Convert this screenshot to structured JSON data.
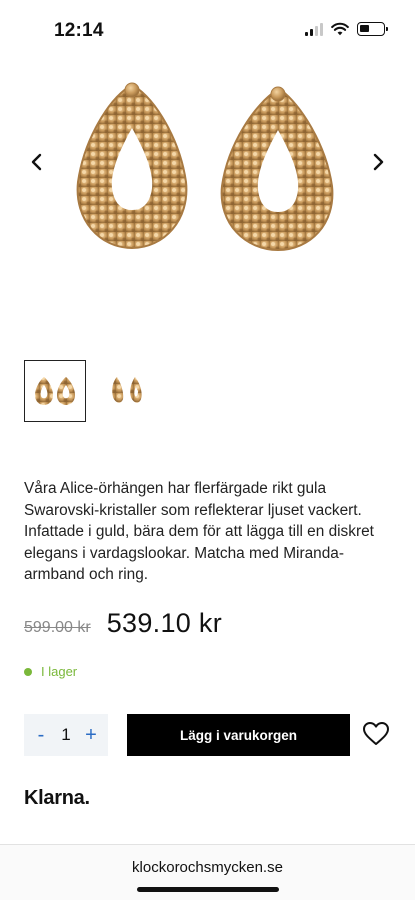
{
  "status_bar": {
    "time": "12:14"
  },
  "gallery": {
    "prev_icon": "chevron-left-icon",
    "next_icon": "chevron-right-icon",
    "thumbnails": [
      "earrings-front",
      "earrings-side"
    ],
    "active_thumbnail": 0,
    "gem_color": "#c99a5c"
  },
  "product": {
    "description": "Våra Alice-örhängen har flerfärgade rikt gula Swarovski-kristaller som reflekterar ljuset vackert. Infattade i guld, bära dem för att lägga till en diskret elegans i vardagslookar. Matcha med Miranda-armband och ring.",
    "old_price": "599.00 kr",
    "price": "539.10 kr",
    "stock_status": "I lager"
  },
  "cart": {
    "minus_label": "-",
    "quantity": "1",
    "plus_label": "+",
    "add_label": "Lägg i varukorgen"
  },
  "payment": {
    "provider": "Klarna."
  },
  "browser": {
    "url": "klockorochsmycken.se"
  },
  "colors": {
    "accent": "#2b6cc4",
    "in_stock": "#7ab83a",
    "button": "#000000"
  }
}
